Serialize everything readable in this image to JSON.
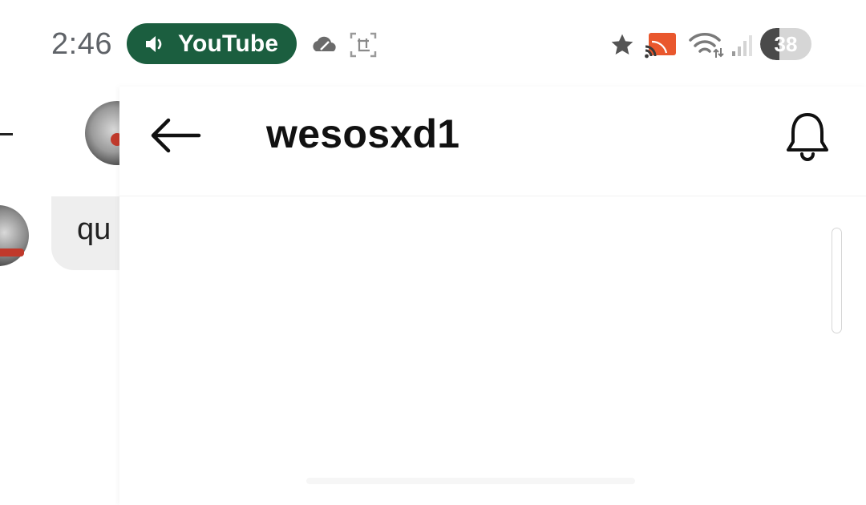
{
  "status_bar": {
    "time": "2:46",
    "media_pill": {
      "icon": "speaker-icon",
      "label": "YouTube",
      "color": "#1b5e3f"
    },
    "right_icons": [
      "star-icon",
      "cast-icon",
      "wifi-icon",
      "signal-icon"
    ],
    "battery_level": "38"
  },
  "background_chat": {
    "message_preview": "qu"
  },
  "header": {
    "back_icon": "back-arrow-icon",
    "title": "wesosxd1",
    "notification_icon": "bell-icon"
  }
}
